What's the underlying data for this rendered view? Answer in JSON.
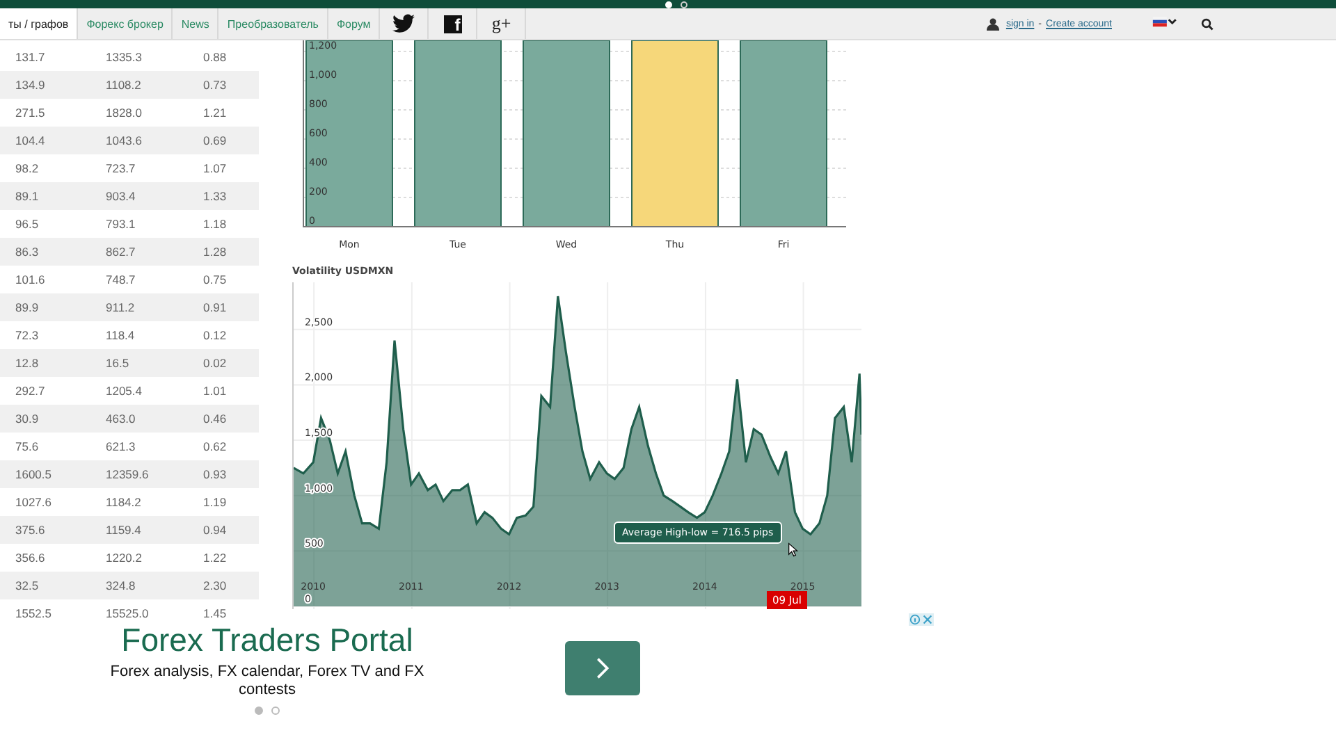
{
  "top_pager": [
    {
      "selected": true
    },
    {
      "selected": false
    }
  ],
  "nav": {
    "tabs": [
      {
        "label": "ты / графов",
        "selected": true
      },
      {
        "label": "Форекс брокер",
        "selected": false
      },
      {
        "label": "News",
        "selected": false
      },
      {
        "label": "Преобразователь",
        "selected": false
      },
      {
        "label": "Форум",
        "selected": false
      }
    ],
    "social": [
      {
        "kind": "bird"
      },
      {
        "kind": "glyph",
        "text": "f"
      },
      {
        "kind": "plain",
        "text": "g+"
      }
    ],
    "account": {
      "sign_in": "sign in",
      "separator": "-",
      "create": "Create account"
    }
  },
  "table": {
    "rows": [
      [
        "131.7",
        "1335.3",
        "0.88"
      ],
      [
        "134.9",
        "1108.2",
        "0.73"
      ],
      [
        "271.5",
        "1828.0",
        "1.21"
      ],
      [
        "104.4",
        "1043.6",
        "0.69"
      ],
      [
        "98.2",
        "723.7",
        "1.07"
      ],
      [
        "89.1",
        "903.4",
        "1.33"
      ],
      [
        "96.5",
        "793.1",
        "1.18"
      ],
      [
        "86.3",
        "862.7",
        "1.28"
      ],
      [
        "101.6",
        "748.7",
        "0.75"
      ],
      [
        "89.9",
        "911.2",
        "0.91"
      ],
      [
        "72.3",
        "118.4",
        "0.12"
      ],
      [
        "12.8",
        "16.5",
        "0.02"
      ],
      [
        "292.7",
        "1205.4",
        "1.01"
      ],
      [
        "30.9",
        "463.0",
        "0.46"
      ],
      [
        "75.6",
        "621.3",
        "0.62"
      ],
      [
        "1600.5",
        "12359.6",
        "0.93"
      ],
      [
        "1027.6",
        "1184.2",
        "1.19"
      ],
      [
        "375.6",
        "1159.4",
        "0.94"
      ],
      [
        "356.6",
        "1220.2",
        "1.22"
      ],
      [
        "32.5",
        "324.8",
        "2.30"
      ],
      [
        "1552.5",
        "15525.0",
        "1.45"
      ]
    ]
  },
  "bar_chart": {
    "yticks": [
      "1,200",
      "1,000",
      "800",
      "600",
      "400",
      "200",
      "0"
    ],
    "days": [
      {
        "label": "Mon",
        "highlighted": false
      },
      {
        "label": "Tue",
        "highlighted": false
      },
      {
        "label": "Wed",
        "highlighted": false
      },
      {
        "label": "Thu",
        "highlighted": true
      },
      {
        "label": "Fri",
        "highlighted": false
      }
    ]
  },
  "volatility": {
    "chart_data": {
      "type": "area",
      "title": "Volatility USDMXN",
      "grid": true,
      "ylim": [
        0,
        2900
      ],
      "xlim": [
        2009.8,
        2015.6
      ],
      "yticks": [
        {
          "value": 0,
          "label": "0"
        },
        {
          "value": 500,
          "label": "500"
        },
        {
          "value": 1000,
          "label": "1,000"
        },
        {
          "value": 1500,
          "label": "1,500"
        },
        {
          "value": 2000,
          "label": "2,000"
        },
        {
          "value": 2500,
          "label": "2,500"
        }
      ],
      "xticks": [
        2010,
        2011,
        2012,
        2013,
        2014,
        2015
      ],
      "x": [
        2009.8,
        2009.9,
        2010.0,
        2010.08,
        2010.17,
        2010.25,
        2010.33,
        2010.42,
        2010.5,
        2010.58,
        2010.67,
        2010.75,
        2010.83,
        2010.92,
        2011.0,
        2011.08,
        2011.17,
        2011.25,
        2011.33,
        2011.42,
        2011.5,
        2011.58,
        2011.67,
        2011.75,
        2011.83,
        2011.92,
        2012.0,
        2012.08,
        2012.17,
        2012.25,
        2012.33,
        2012.42,
        2012.5,
        2012.58,
        2012.67,
        2012.75,
        2012.83,
        2012.92,
        2013.0,
        2013.08,
        2013.17,
        2013.25,
        2013.33,
        2013.42,
        2013.5,
        2013.58,
        2013.67,
        2013.75,
        2013.83,
        2013.92,
        2014.0,
        2014.08,
        2014.17,
        2014.25,
        2014.33,
        2014.42,
        2014.5,
        2014.58,
        2014.67,
        2014.75,
        2014.83,
        2014.92,
        2015.0,
        2015.08,
        2015.17,
        2015.25,
        2015.33,
        2015.42,
        2015.5,
        2015.58,
        2015.6
      ],
      "series": [
        {
          "color": "#1f5e4c",
          "values": [
            1250,
            1200,
            1300,
            1700,
            1500,
            1200,
            1400,
            1000,
            750,
            750,
            700,
            1300,
            2400,
            1600,
            1100,
            1200,
            1050,
            1100,
            950,
            1050,
            1050,
            1100,
            750,
            850,
            800,
            700,
            650,
            800,
            820,
            900,
            1900,
            1800,
            2800,
            2300,
            1800,
            1400,
            1150,
            1300,
            1200,
            1150,
            1250,
            1600,
            1800,
            1450,
            1200,
            1000,
            950,
            900,
            850,
            800,
            850,
            1000,
            1200,
            1400,
            2050,
            1300,
            1600,
            1550,
            1350,
            1200,
            1400,
            850,
            700,
            650,
            750,
            1000,
            1700,
            1800,
            1300,
            2100,
            1550
          ]
        }
      ]
    },
    "tooltip": "Average High-low = 716.5 pips",
    "date_marker": "09 Jul"
  },
  "ad": {
    "title": "Forex Traders Portal",
    "text": "Forex analysis, FX calendar, Forex TV and FX contests",
    "dots": [
      {
        "selected": true
      },
      {
        "selected": false
      }
    ]
  }
}
